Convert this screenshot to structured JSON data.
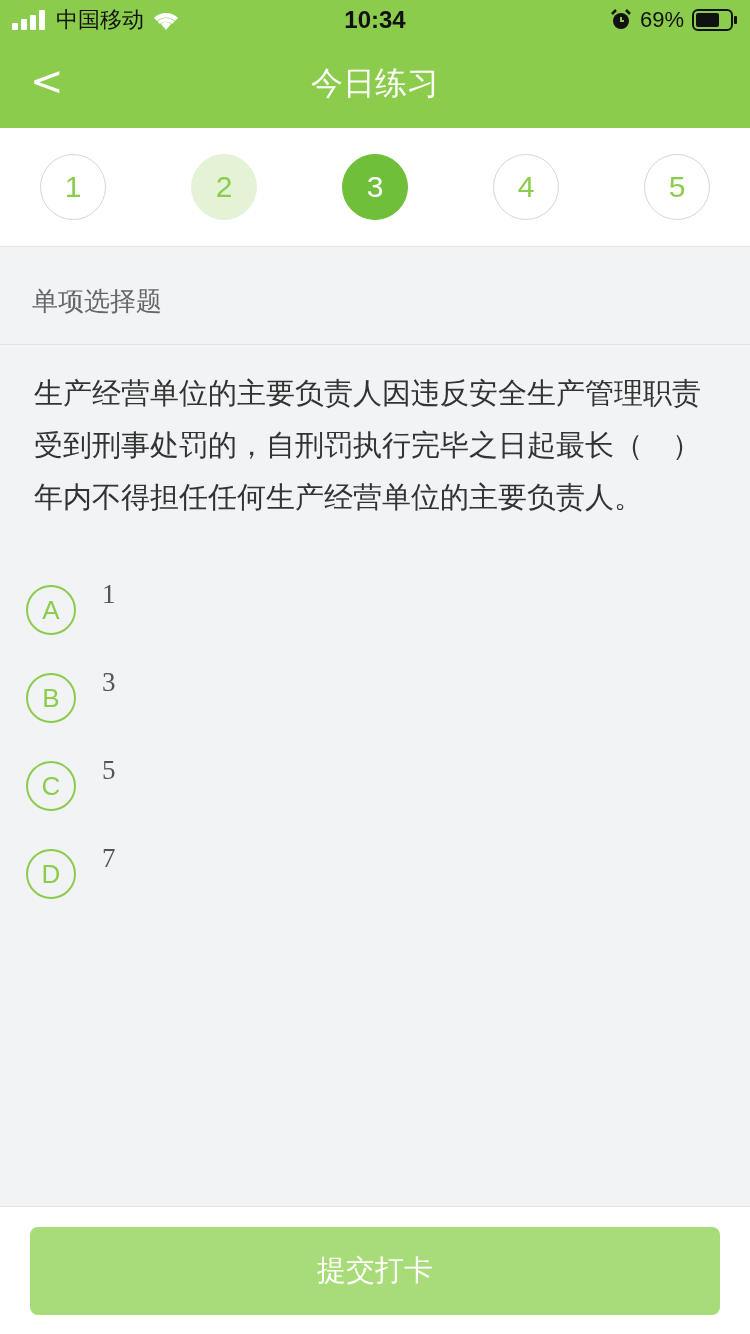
{
  "status_bar": {
    "carrier": "中国移动",
    "time": "10:34",
    "battery": "69%"
  },
  "nav": {
    "back": "<",
    "title": "今日练习"
  },
  "steps": [
    {
      "label": "1",
      "answered": false,
      "selected": false
    },
    {
      "label": "2",
      "answered": true,
      "selected": false
    },
    {
      "label": "3",
      "answered": false,
      "selected": true
    },
    {
      "label": "4",
      "answered": false,
      "selected": false
    },
    {
      "label": "5",
      "answered": false,
      "selected": false
    }
  ],
  "section": "单项选择题",
  "question": "生产经营单位的主要负责人因违反安全生产管理职责受到刑事处罚的，自刑罚执行完毕之日起最长（　）年内不得担任任何生产经营单位的主要负责人。",
  "options": [
    {
      "letter": "A",
      "text": "1",
      "selected": false
    },
    {
      "letter": "B",
      "text": "3",
      "selected": false
    },
    {
      "letter": "C",
      "text": "5",
      "selected": false
    },
    {
      "letter": "D",
      "text": "7",
      "selected": false
    }
  ],
  "submit": {
    "label": "提交打卡",
    "disabled": true
  }
}
